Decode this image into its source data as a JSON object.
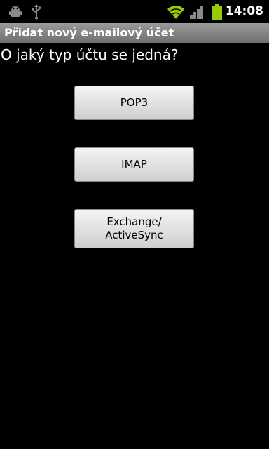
{
  "status_bar": {
    "time": "14:08",
    "icons": [
      "android-debug-icon",
      "usb-icon",
      "wifi-icon",
      "signal-icon",
      "battery-icon"
    ],
    "colors": {
      "wifi": "#99cc00",
      "battery": "#99cc00",
      "signal": "#8a8a8a"
    }
  },
  "title_bar": {
    "title": "Přidat nový e-mailový účet"
  },
  "main": {
    "question": "O jaký typ účtu se jedná?",
    "buttons": [
      {
        "label": "POP3"
      },
      {
        "label": "IMAP"
      },
      {
        "label": "Exchange/\nActiveSync"
      }
    ]
  }
}
